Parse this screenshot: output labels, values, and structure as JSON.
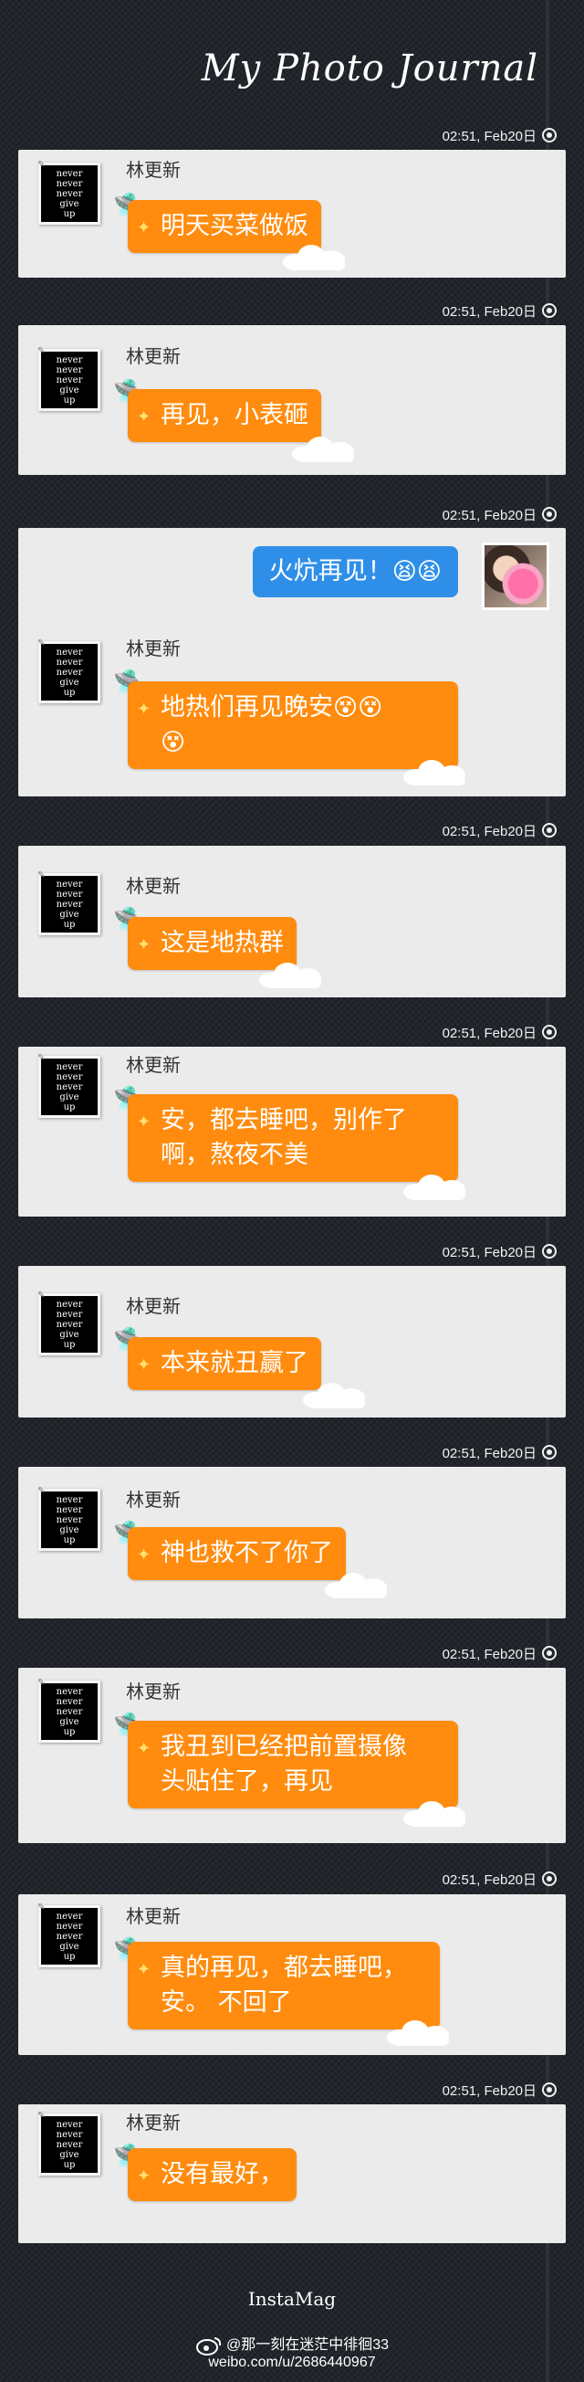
{
  "header": {
    "title": "My Photo Journal"
  },
  "timestamp": "02:51, Feb20日",
  "contact": {
    "name": "林更新",
    "avatar_text": [
      "never",
      "never",
      "never",
      "give",
      "up"
    ]
  },
  "icons": {
    "ufo": "ufo-icon",
    "sparkle": "sparkle-icon",
    "cloud": "cloud-decoration",
    "timestamp": "radio-dot-icon",
    "emoji": "face-emoji-icon"
  },
  "colors": {
    "background": "#22252c",
    "card": "#ebebeb",
    "bubble_in": "#ff8c0f",
    "bubble_out": "#2f8fe8"
  },
  "messages": [
    {
      "text": "明天买菜做饭"
    },
    {
      "text": "再见，小表砸"
    },
    {
      "outgoing_text": "火炕再见！",
      "text": "地热们再见晚安"
    },
    {
      "text": "这是地热群"
    },
    {
      "line1": "安，都去睡吧，别作了",
      "line2": "啊，熬夜不美"
    },
    {
      "text": "本来就丑赢了"
    },
    {
      "text": "神也救不了你了"
    },
    {
      "line1": "我丑到已经把前置摄像",
      "line2": "头贴住了，再见"
    },
    {
      "line1": "真的再见，都去睡吧，",
      "line2": "安。  不回了"
    },
    {
      "text": "没有最好，"
    }
  ],
  "footer": {
    "brand": "InstaMag",
    "weibo_handle": "@那一刻在迷茫中徘徊33",
    "weibo_url": "weibo.com/u/2686440967"
  }
}
